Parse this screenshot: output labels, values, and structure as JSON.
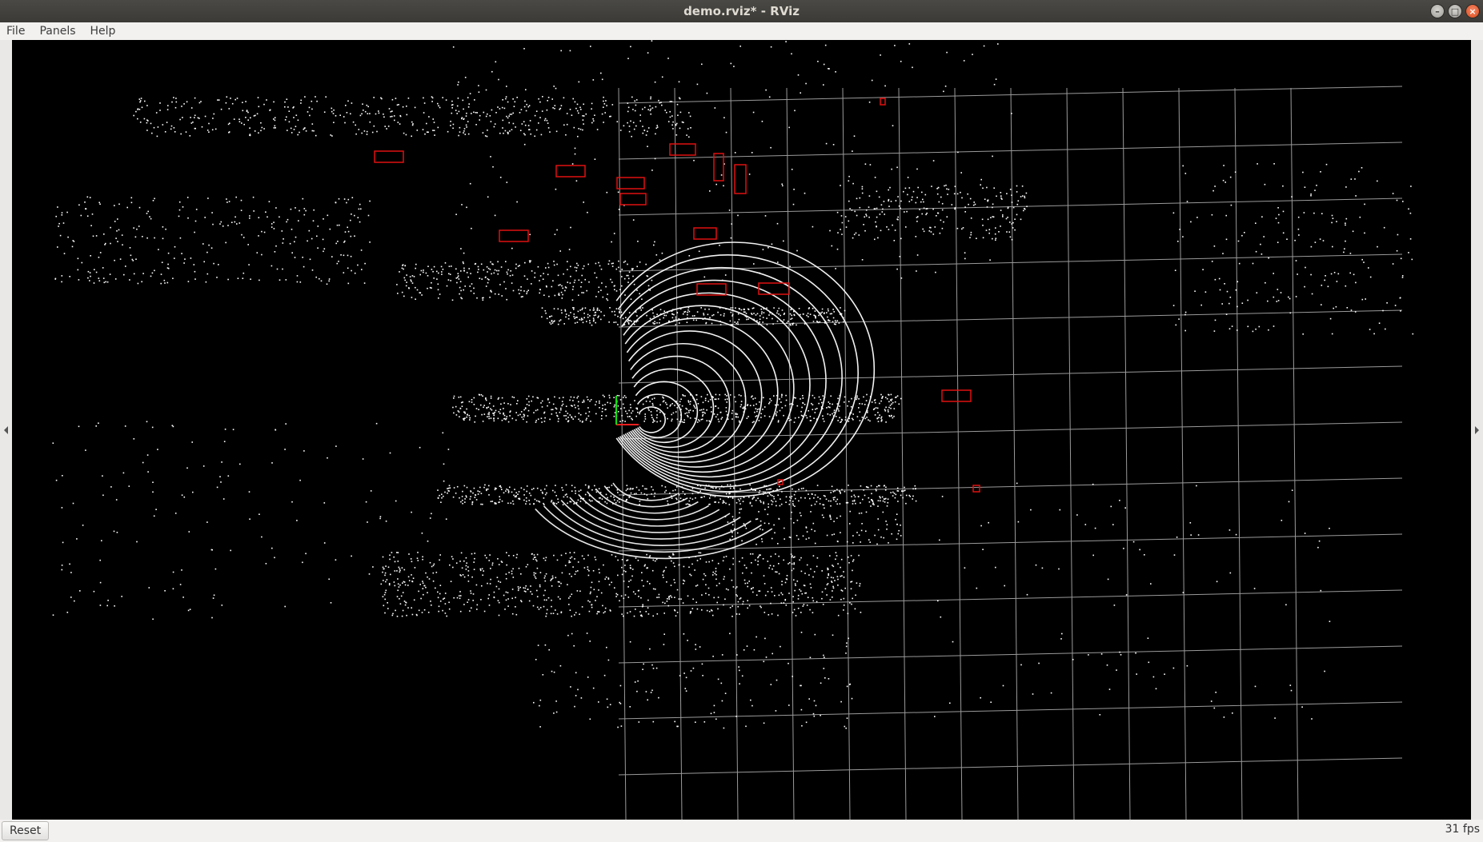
{
  "window": {
    "title": "demo.rviz* - RViz",
    "controls": {
      "minimize": "–",
      "maximize": "□",
      "close": "×"
    }
  },
  "menu": {
    "items": [
      {
        "label": "File",
        "mnemonic": "F"
      },
      {
        "label": "Panels",
        "mnemonic": "P"
      },
      {
        "label": "Help",
        "mnemonic": "H"
      }
    ]
  },
  "colors": {
    "background": "#000000",
    "grid": "#a0a0a0",
    "points": "#ffffff",
    "bbox": "#e01010",
    "axis_x": "#ff0000",
    "axis_y": "#00ff00"
  },
  "icons": {
    "left_collapse": "triangle-left",
    "right_collapse": "triangle-right"
  },
  "status": {
    "reset_label": "Reset",
    "fps": "31 fps"
  }
}
